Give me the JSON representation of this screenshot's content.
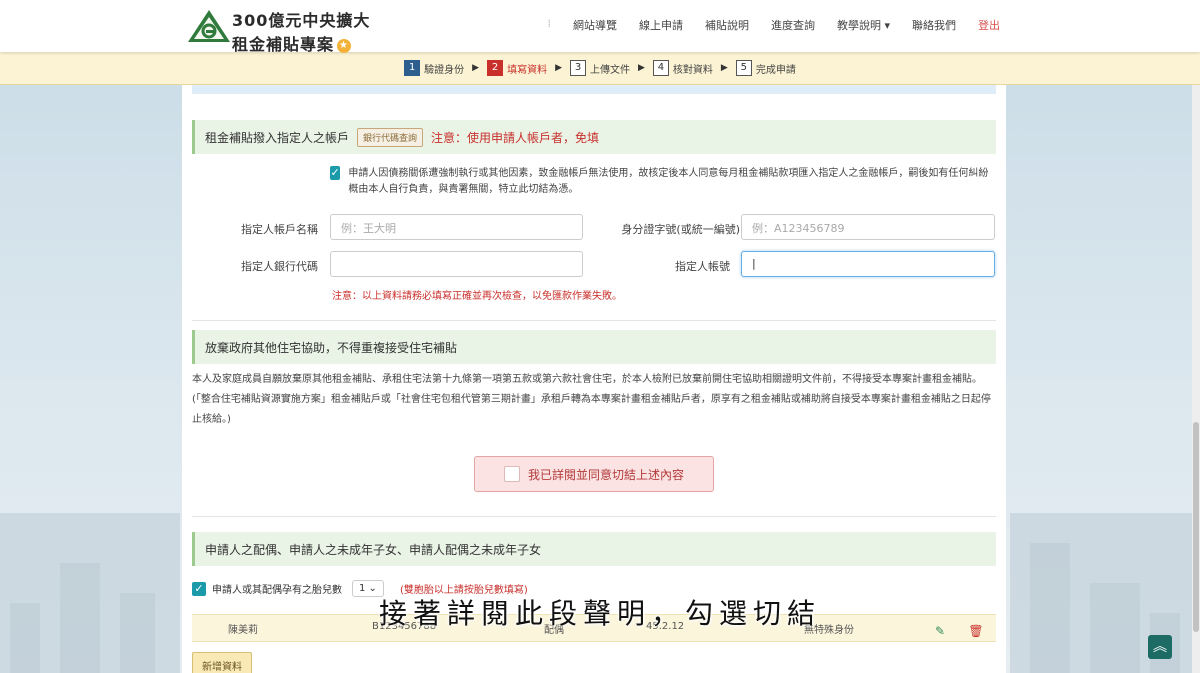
{
  "header": {
    "logo_line1": "300億元中央擴大",
    "logo_line2": "租金補貼專案",
    "nav": [
      {
        "label": "網站導覽"
      },
      {
        "label": "線上申請"
      },
      {
        "label": "補貼說明"
      },
      {
        "label": "進度查詢"
      },
      {
        "label": "教學說明 ▾"
      },
      {
        "label": "聯絡我們"
      },
      {
        "label": "登出"
      }
    ]
  },
  "steps": [
    {
      "num": "1",
      "label": "驗證身份"
    },
    {
      "num": "2",
      "label": "填寫資料"
    },
    {
      "num": "3",
      "label": "上傳文件"
    },
    {
      "num": "4",
      "label": "核對資料"
    },
    {
      "num": "5",
      "label": "完成申請"
    }
  ],
  "designee": {
    "title": "租金補貼撥入指定人之帳戶",
    "bank_code_btn": "銀行代碼查詢",
    "warning": "注意：使用申請人帳戶者，免填",
    "checkbox_text": "申請人因債務關係遭強制執行或其他因素，致金融帳戶無法使用，故核定後本人同意每月租金補貼款項匯入指定人之金融帳戶，嗣後如有任何糾紛概由本人自行負責，與貴署無關，特立此切結為憑。",
    "name_label": "指定人帳戶名稱",
    "name_placeholder": "例：王大明",
    "id_label": "身分證字號(或統一編號)",
    "id_placeholder": "例：A123456789",
    "bank_label": "指定人銀行代碼",
    "account_label": "指定人帳號",
    "account_value": "|",
    "note": "注意：以上資料請務必填寫正確並再次檢查，以免匯款作業失敗。"
  },
  "waiver": {
    "title": "放棄政府其他住宅協助，不得重複接受住宅補貼",
    "text": "本人及家庭成員自願放棄原其他租金補貼、承租住宅法第十九條第一項第五款或第六款社會住宅，於本人檢附已放棄前開住宅協助相關證明文件前，不得接受本專案計畫租金補貼。(「整合住宅補貼資源實施方案」租金補貼戶或「社會住宅包租代管第三期計畫」承租戶轉為本專案計畫租金補貼戶者，原享有之租金補貼或補助將自接受本專案計畫租金補貼之日起停止核給。)",
    "agree_label": "我已詳閱並同意切結上述內容"
  },
  "family": {
    "title": "申請人之配偶、申請人之未成年子女、申請人配偶之未成年子女",
    "pregnant_label": "申請人或其配偶孕有之胎兒數",
    "pregnant_value": "1",
    "pregnant_hint": "(雙胞胎以上請按胎兒數填寫)",
    "row": {
      "name": "陳美莉",
      "id": "B123456788",
      "relation": "配偶",
      "birth": "45.2.12",
      "status": "無特殊身份"
    },
    "add_label": "新增資料"
  },
  "subtitle": "接著詳閱此段聲明，勾選切結",
  "colors": {
    "accent_red": "#c9302c",
    "teal": "#1b9aaa",
    "section_green": "#e9f3e6",
    "step_bar": "#fbf3d3"
  }
}
